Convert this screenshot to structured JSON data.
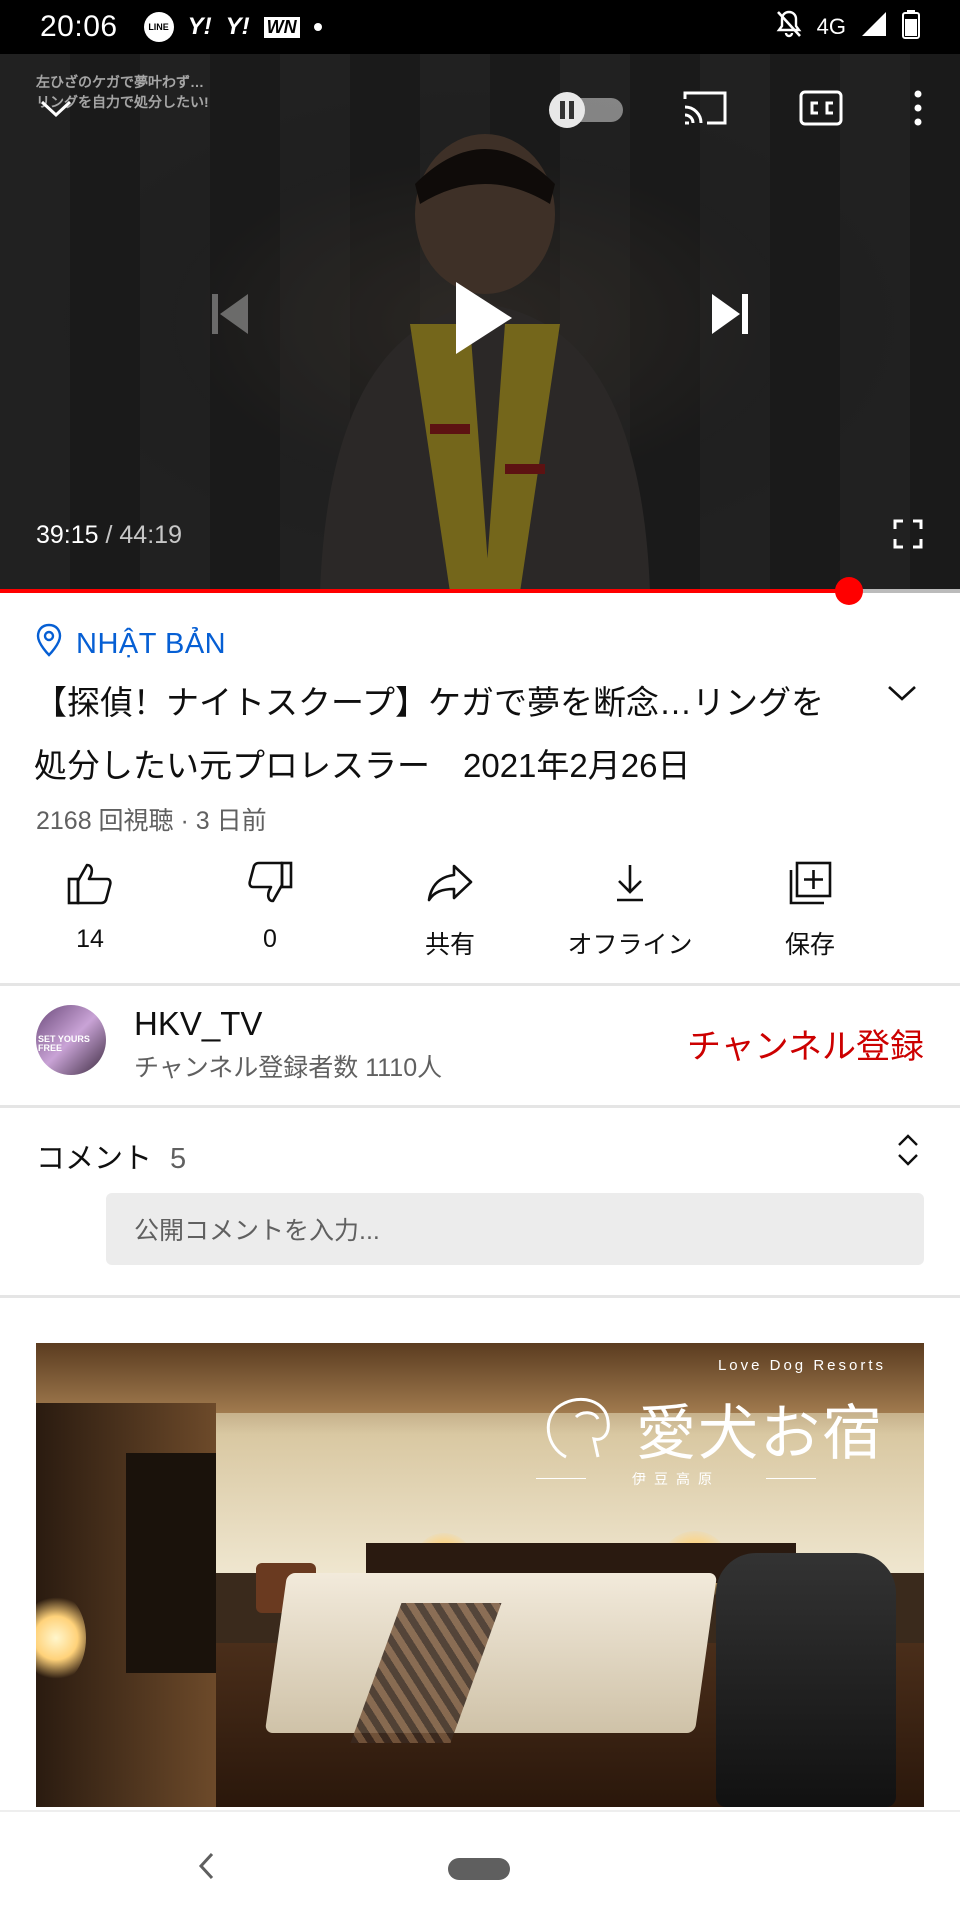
{
  "status_bar": {
    "time": "20:06",
    "apps": [
      "LINE",
      "Y!",
      "Y!",
      "WN"
    ],
    "network": "4G"
  },
  "player": {
    "overlay_caption_line1": "左ひざのケガで夢叶わず…",
    "overlay_caption_line2": "リングを自力で処分したい!",
    "current_time": "39:15",
    "separator": " / ",
    "duration": "44:19",
    "progress_fraction": 0.884,
    "progress_color": "#ff0000"
  },
  "video_info": {
    "location": "NHẬT BẢN",
    "title": "【探偵！ナイトスクープ】ケガで夢を断念…リングを処分したい元プロレスラー　2021年2月26日",
    "meta": "2168 回視聴 · 3 日前",
    "link_color": "#065fd4"
  },
  "actions": [
    {
      "icon": "thumbs-up-icon",
      "label": "14"
    },
    {
      "icon": "thumbs-down-icon",
      "label": "0"
    },
    {
      "icon": "share-icon",
      "label": "共有"
    },
    {
      "icon": "download-icon",
      "label": "オフライン"
    },
    {
      "icon": "add-to-playlist-icon",
      "label": "保存"
    }
  ],
  "channel": {
    "avatar_text": "SET YOURS FREE",
    "name": "HKV_TV",
    "subscribers": "チャンネル登録者数 1110人",
    "subscribe_label": "チャンネル登録",
    "subscribe_color": "#cc0000"
  },
  "comments": {
    "heading": "コメント",
    "count": "5",
    "placeholder": "公開コメントを入力..."
  },
  "ad": {
    "brand_en": "Love Dog Resorts",
    "brand_jp": "愛犬お宿",
    "brand_sub": "伊豆高原"
  }
}
